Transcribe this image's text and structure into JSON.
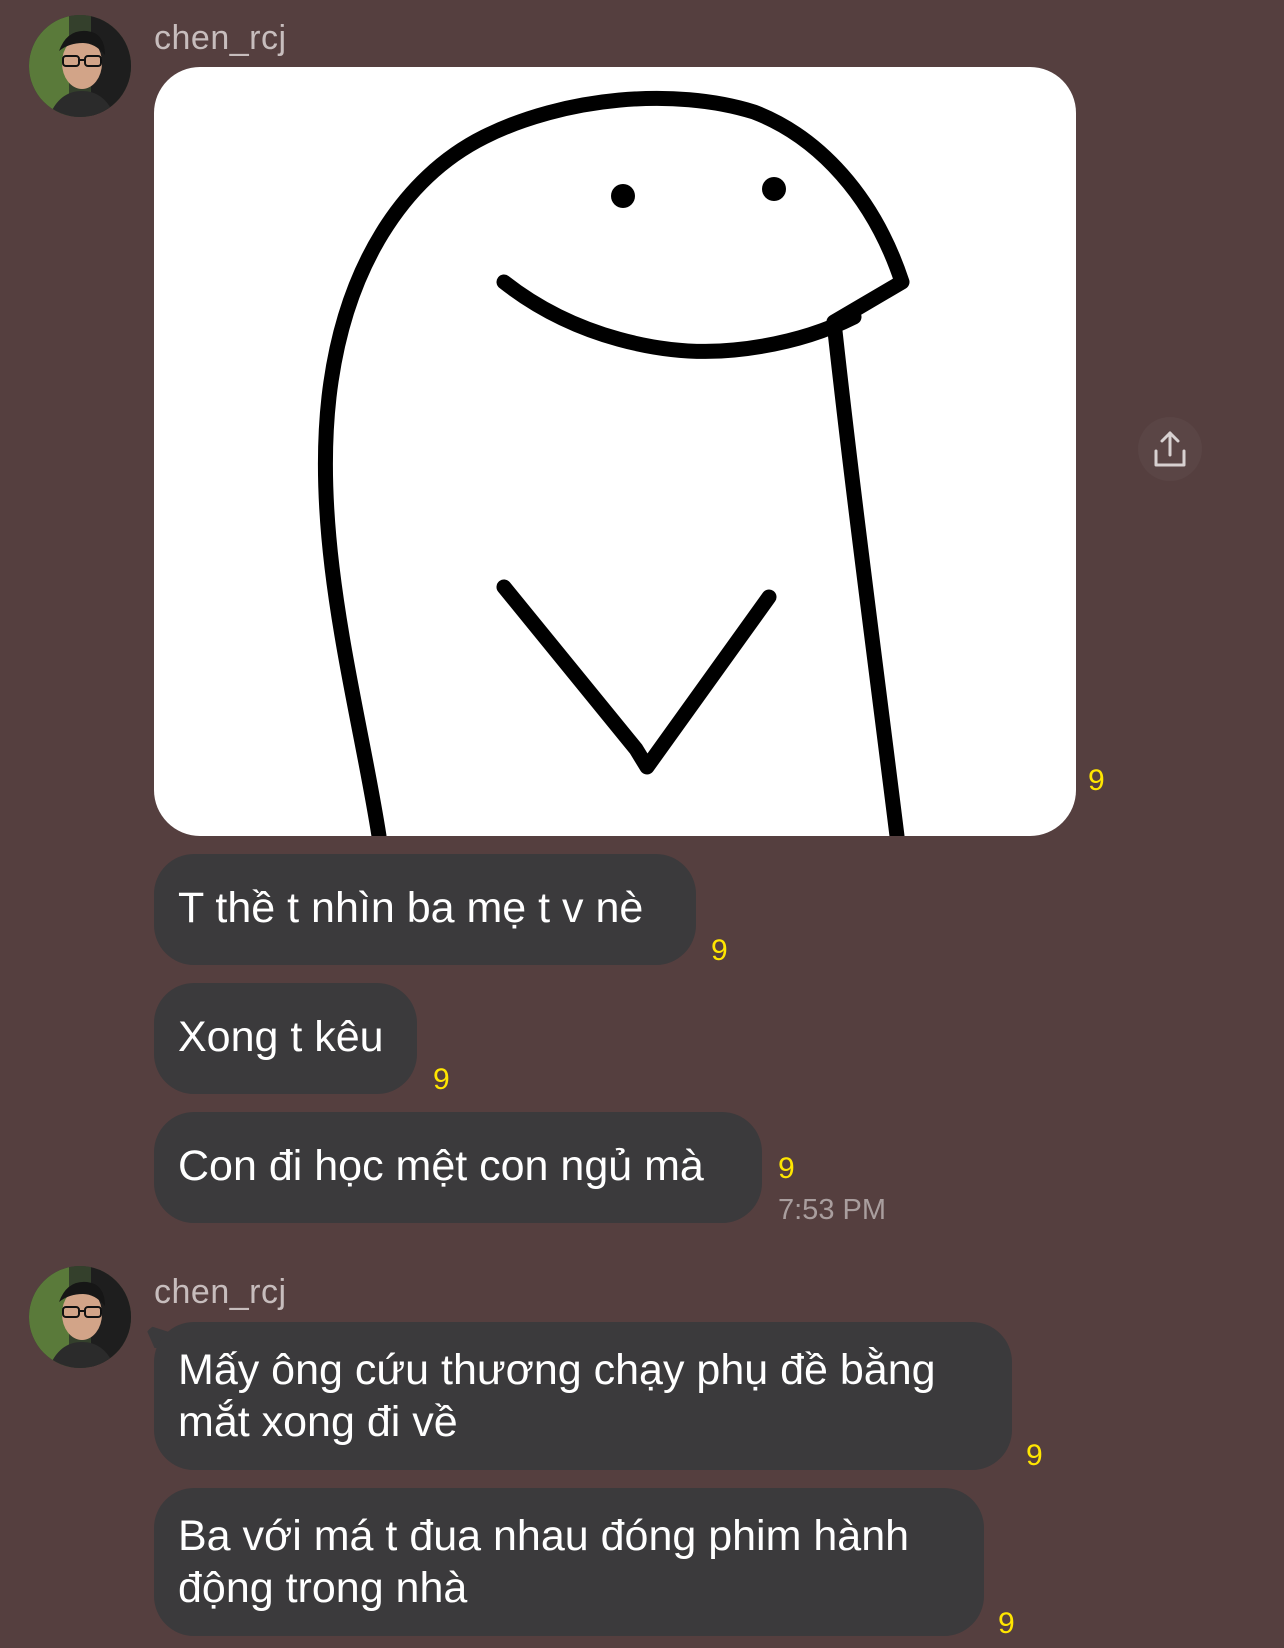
{
  "messages_group_1": {
    "sender": "chen_rcj",
    "image_reaction": "9",
    "messages": [
      {
        "text": "T thề t nhìn ba mẹ t v nè",
        "reaction": "9"
      },
      {
        "text": "Xong t kêu",
        "reaction": "9"
      },
      {
        "text": "Con đi học mệt con ngủ mà",
        "reaction": "9"
      }
    ],
    "timestamp": "7:53 PM"
  },
  "messages_group_2": {
    "sender": "chen_rcj",
    "messages": [
      {
        "line1": "Mấy ông cứu thương chạy phụ đề bằng",
        "line2": "mắt xong đi về",
        "reaction": "9"
      },
      {
        "line1": "Ba với má t đua nhau đóng phim hành",
        "line2": "động trong nhà",
        "reaction": "9"
      }
    ]
  },
  "icons": {
    "share": "share-icon",
    "avatar": "profile-photo"
  },
  "colors": {
    "background": "#553f3f",
    "bubble": "#3b3a3c",
    "reaction": "#ffe600",
    "sender": "#c7bdbd"
  }
}
